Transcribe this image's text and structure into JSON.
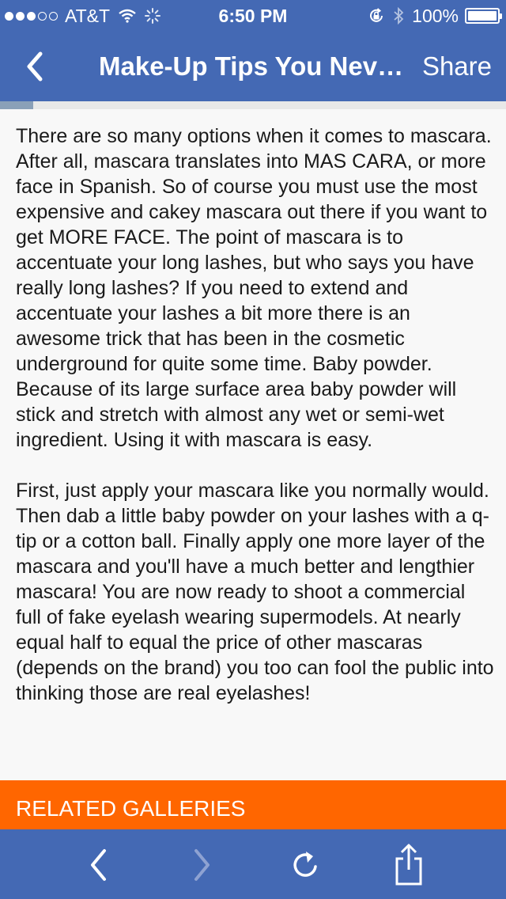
{
  "status_bar": {
    "carrier": "AT&T",
    "time": "6:50 PM",
    "battery": "100%",
    "battery_level": 1.0,
    "signal_bars_filled": 3,
    "signal_bars_total": 5
  },
  "nav": {
    "back_icon": "chevron-left-icon",
    "title": "Make-Up Tips You Nev…",
    "share_label": "Share"
  },
  "article": {
    "paragraphs": [
      "There are so many options when it comes to mascara. After all, mascara translates into MAS CARA, or more face in Spanish. So of course you must use the most expensive and cakey mascara out there if you want to get MORE FACE. The point of mascara is to accentuate your long lashes, but who says you have really long lashes? If you need to extend and accentuate your lashes a bit more there is an awesome trick that has been in the cosmetic underground for quite some time. Baby powder. Because of its large surface area baby powder will stick and stretch with almost any wet or semi-wet ingredient. Using it with mascara is easy.",
      "First, just apply your mascara like you normally would. Then dab a little baby powder on your lashes with a q-tip or a cotton ball. Finally apply one more layer of the mascara and you'll have a much better and lengthier mascara! You are now ready to shoot a commercial full of fake eyelash wearing supermodels. At nearly equal half to equal the price of other mascaras (depends on the brand) you too can fool the public into thinking those are real eyelashes!"
    ]
  },
  "related": {
    "header": "RELATED GALLERIES"
  },
  "toolbar": {
    "icons": [
      "chevron-left-icon",
      "chevron-right-icon",
      "reload-icon",
      "share-icon"
    ],
    "forward_enabled": false
  },
  "colors": {
    "nav_blue": "#4469b4",
    "accent_orange": "#ff6600",
    "text": "#1a1a1a",
    "disabled_icon": "#8ea2d2"
  }
}
